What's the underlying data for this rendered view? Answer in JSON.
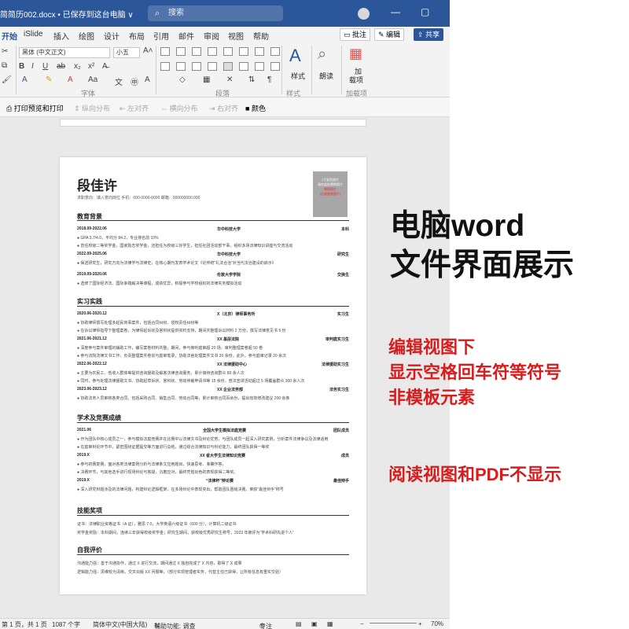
{
  "titlebar": {
    "doc_title": "简简历002.docx • 已保存到这台电脑 ∨",
    "search_placeholder": "搜索",
    "minimize": "—",
    "restore": "▢"
  },
  "tabs": {
    "items": [
      "开始",
      "iSlide",
      "插入",
      "绘图",
      "设计",
      "布局",
      "引用",
      "邮件",
      "审阅",
      "视图",
      "帮助"
    ],
    "comment_button": "批注",
    "edit_button": "编辑",
    "share_button": "共享"
  },
  "ribbon": {
    "font_name": "黑体 (中文正文)",
    "font_size": "小五",
    "group_font": "字体",
    "group_paragraph": "段落",
    "group_style": "样式",
    "group_addins": "加载项",
    "style_label": "样式",
    "assist_label": "朗读",
    "addins_label_1": "加",
    "addins_label_2": "载项"
  },
  "subtoolbar": {
    "print_preview": "打印预览和打印",
    "distribute_vertical": "纵向分布",
    "align_left": "左对齐",
    "distribute_horizontal": "横向分布",
    "align_right": "右对齐",
    "color": "颜色"
  },
  "resume": {
    "name": "段佳许",
    "contact": "求职意向：填入意向岗位          手机：000-0000-0000          邮箱：000000000.000",
    "photo_lines": [
      "1寸彩色照片",
      "请在此处替换照片",
      "替换图片",
      "(右键更换图片)"
    ],
    "sections": {
      "education": "教育背景",
      "experience": "实习实践",
      "academic": "学术及竞赛成绩",
      "skills": "技能奖项",
      "self_eval": "自我评价"
    },
    "education": [
      {
        "date": "2018.09-2022.06",
        "school": "华中科技大学",
        "degree": "本科",
        "lines": [
          "● GPA 3.7/4.0，平均分 84.2，专业排名前 10%",
          "● 曾任校级二等奖学金，国家励志奖学金，还担任为校级三好学生，担任社团活动部干事，组织多场法律知识讲座与交流活动"
        ]
      },
      {
        "date": "2022.09-2025.06",
        "school": "华中科技大学",
        "degree": "研究生",
        "lines": [
          "● 保送研究生，研究方向为法律学与法律史，在核心期刊发表学术论文《论传统“礼法合治”对当代法治建设的启示》"
        ]
      },
      {
        "date": "2019.09-2020.06",
        "school": "伦敦大学学院",
        "degree": "交换生",
        "lines": [
          "● 选修了国际经济法、国际争端解决等课程，成绩优异，积极参与学校组织的法律实务模拟活动"
        ]
      }
    ],
    "experience": [
      {
        "date": "2020.06-2020.12",
        "org": "X（北京）律师事务所",
        "role": "实习生",
        "lines": [
          "● 协助律师撰写处理多起民商事案件，包括合同纠纷、侵权责任纠纷等",
          "● 在诉讼律师指导下整理案卷，为律师起诉状及答辩状提供资料支持，期间共整理诉讼材料 2 万份，撰写法律意见书 5 份"
        ]
      },
      {
        "date": "2021.06-2021.12",
        "org": "XX 基层法院",
        "role": "审判庭实习生",
        "lines": [
          "● 深度参与案件审理的辅助工作，编写案卷材料共整，期间，参与旁听庭审超 20 场，审判整理案卷超 50 卷",
          "● 参与法院法律文书工作，负责整理案件卷宗与庭审笔录，协助法官处理案件文书 30 余份，此外，参与庭审记录 20 余次"
        ]
      },
      {
        "date": "2022.06-2022.12",
        "org": "XX 法律援助中心",
        "role": "法律援助实习生",
        "lines": [
          "● 主要为农民工、低收入群体等提供咨询援助及解答法律咨询服务，累计接待咨询群众 80 余人次",
          "● 同时，参与处理法律援助文书、协助起草诉状、答辩状、劳动仲裁申请书等 15 余份，普法宣讲活动超过 5 场覆盖群众 300 余人次"
        ]
      },
      {
        "date": "2023.06-2023.12",
        "org": "XX 企业法务部",
        "role": "法务实习生",
        "lines": [
          "● 协助法务人员审核各类合同，包括采购合同、销售合同、劳动合同等，累计审核合同百余份，提出有效修改建议 200 余条"
        ]
      }
    ],
    "academic": [
      {
        "date": "2021.06",
        "title": "全国大学生模拟法庭竞赛",
        "award": "团队成员",
        "lines": [
          "● 作为团队中核心成员之一，参与模拟法庭竞赛并在比赛中以法律文书及辩论优势，与团队成员一起深入研究案例，分析案件法律争议及法律适用",
          "● 在庭审辩论环节中，紧密围绕证据提交等方面进行总结，通过综合法律知识与辩论能力，最终团队获得一等奖"
        ]
      },
      {
        "date": "2019.X",
        "title": "XX 省大学生法律知识竞赛",
        "award": "成员",
        "lines": [
          "● 参与初赛复赛，面对各类法律案例分析与法律条文应用题目，快速思考、准确作答，",
          "● 决赛环节，与其他选手进行现场辩论与答疑，沉着应对，最终凭借出色的表现获得二等奖。"
        ]
      },
      {
        "date": "2019.X",
        "title": "“法律杯”辩论赛",
        "award": "最佳辩手",
        "lines": [
          "● 深入研究辩题涉及的法律问题，构建辩论逻辑框架，在多场辩论中表现突出，帮助团队晋级决赛，荣获“最佳辩手”称号"
        ]
      }
    ],
    "skills": [
      "证书：法律职业资格证书（A 证），雅思 7.0，大学英语六级证书（600 分），计算机二级证书",
      "奖学金奖励：本科期间，连续三年获得校级奖学金；研究生期间，获校级优秀研究生称号，2023 年被评为“学术科研先进个人”"
    ],
    "self_eval": [
      "沟通能力强：善于沟通协作，通过 X 进行交流，期间通过 X 独自完成了 X 内容，取得了 X 成果",
      "逻辑能力强：思维较为清晰，交叉出版 XX 问题等，（部分实现管理者实务，代替主任已获得，让所有信息有重实交验）"
    ]
  },
  "statusbar": {
    "page": "第 1 页，共 1 页",
    "word_count": "1087 个字",
    "language": "简体中文(中国大陆)",
    "accessibility": "辅助功能: 调查",
    "focus": "专注",
    "zoom": "70%"
  },
  "overlay": {
    "headline_1": "电脑word",
    "headline_2": "文件界面展示",
    "red_1": "编辑视图下",
    "red_2": "显示空格回车符等符号",
    "red_3": "非模板元素",
    "red_4": "阅读视图和PDF不显示"
  }
}
